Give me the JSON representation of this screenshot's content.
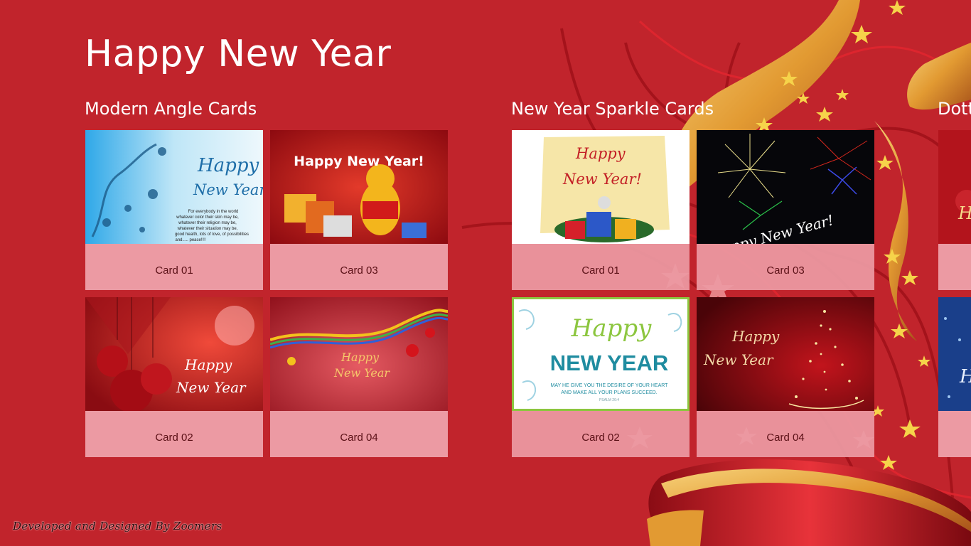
{
  "app": {
    "title": "Happy New Year"
  },
  "groups": [
    {
      "title": "Modern Angle Cards",
      "cards": [
        {
          "label": "Card 01",
          "thumb_text": [
            "Happy",
            "New Year"
          ],
          "thumb_body": [
            "For everybody in the world",
            "whatever color their skin may be,",
            "whatever their religion may be,",
            "whatever their situation may be,",
            "good health, lots of love, of possibilities",
            "and..... peace!!!!"
          ]
        },
        {
          "label": "Card 03",
          "thumb_text": [
            "Happy New Year!"
          ]
        },
        {
          "label": "Card 02",
          "thumb_text": [
            "Happy",
            "New Year"
          ]
        },
        {
          "label": "Card 04",
          "thumb_text": [
            "Happy",
            "New Year"
          ]
        }
      ]
    },
    {
      "title": "New Year Sparkle Cards",
      "cards": [
        {
          "label": "Card 01",
          "thumb_text": [
            "Happy",
            "New Year!"
          ]
        },
        {
          "label": "Card 03",
          "thumb_text": [
            "Happy New Year!"
          ]
        },
        {
          "label": "Card 02",
          "thumb_text": [
            "Happy",
            "NEW YEAR",
            "MAY HE GIVE YOU THE DESIRE OF YOUR HEART",
            "AND MAKE ALL YOUR PLANS SUCCEED.",
            "PSALM 20:4"
          ]
        },
        {
          "label": "Card 04",
          "thumb_text": [
            "Happy",
            "New Year"
          ]
        }
      ]
    },
    {
      "title": "Dotted",
      "cards": []
    }
  ],
  "footer": {
    "credit": "Developed and Designed By Zoomers"
  },
  "colors": {
    "background": "#c1242c",
    "caption": "#ec9aa3",
    "caption_text": "#5a1016",
    "ribbon_gold": "#e9a63c"
  }
}
